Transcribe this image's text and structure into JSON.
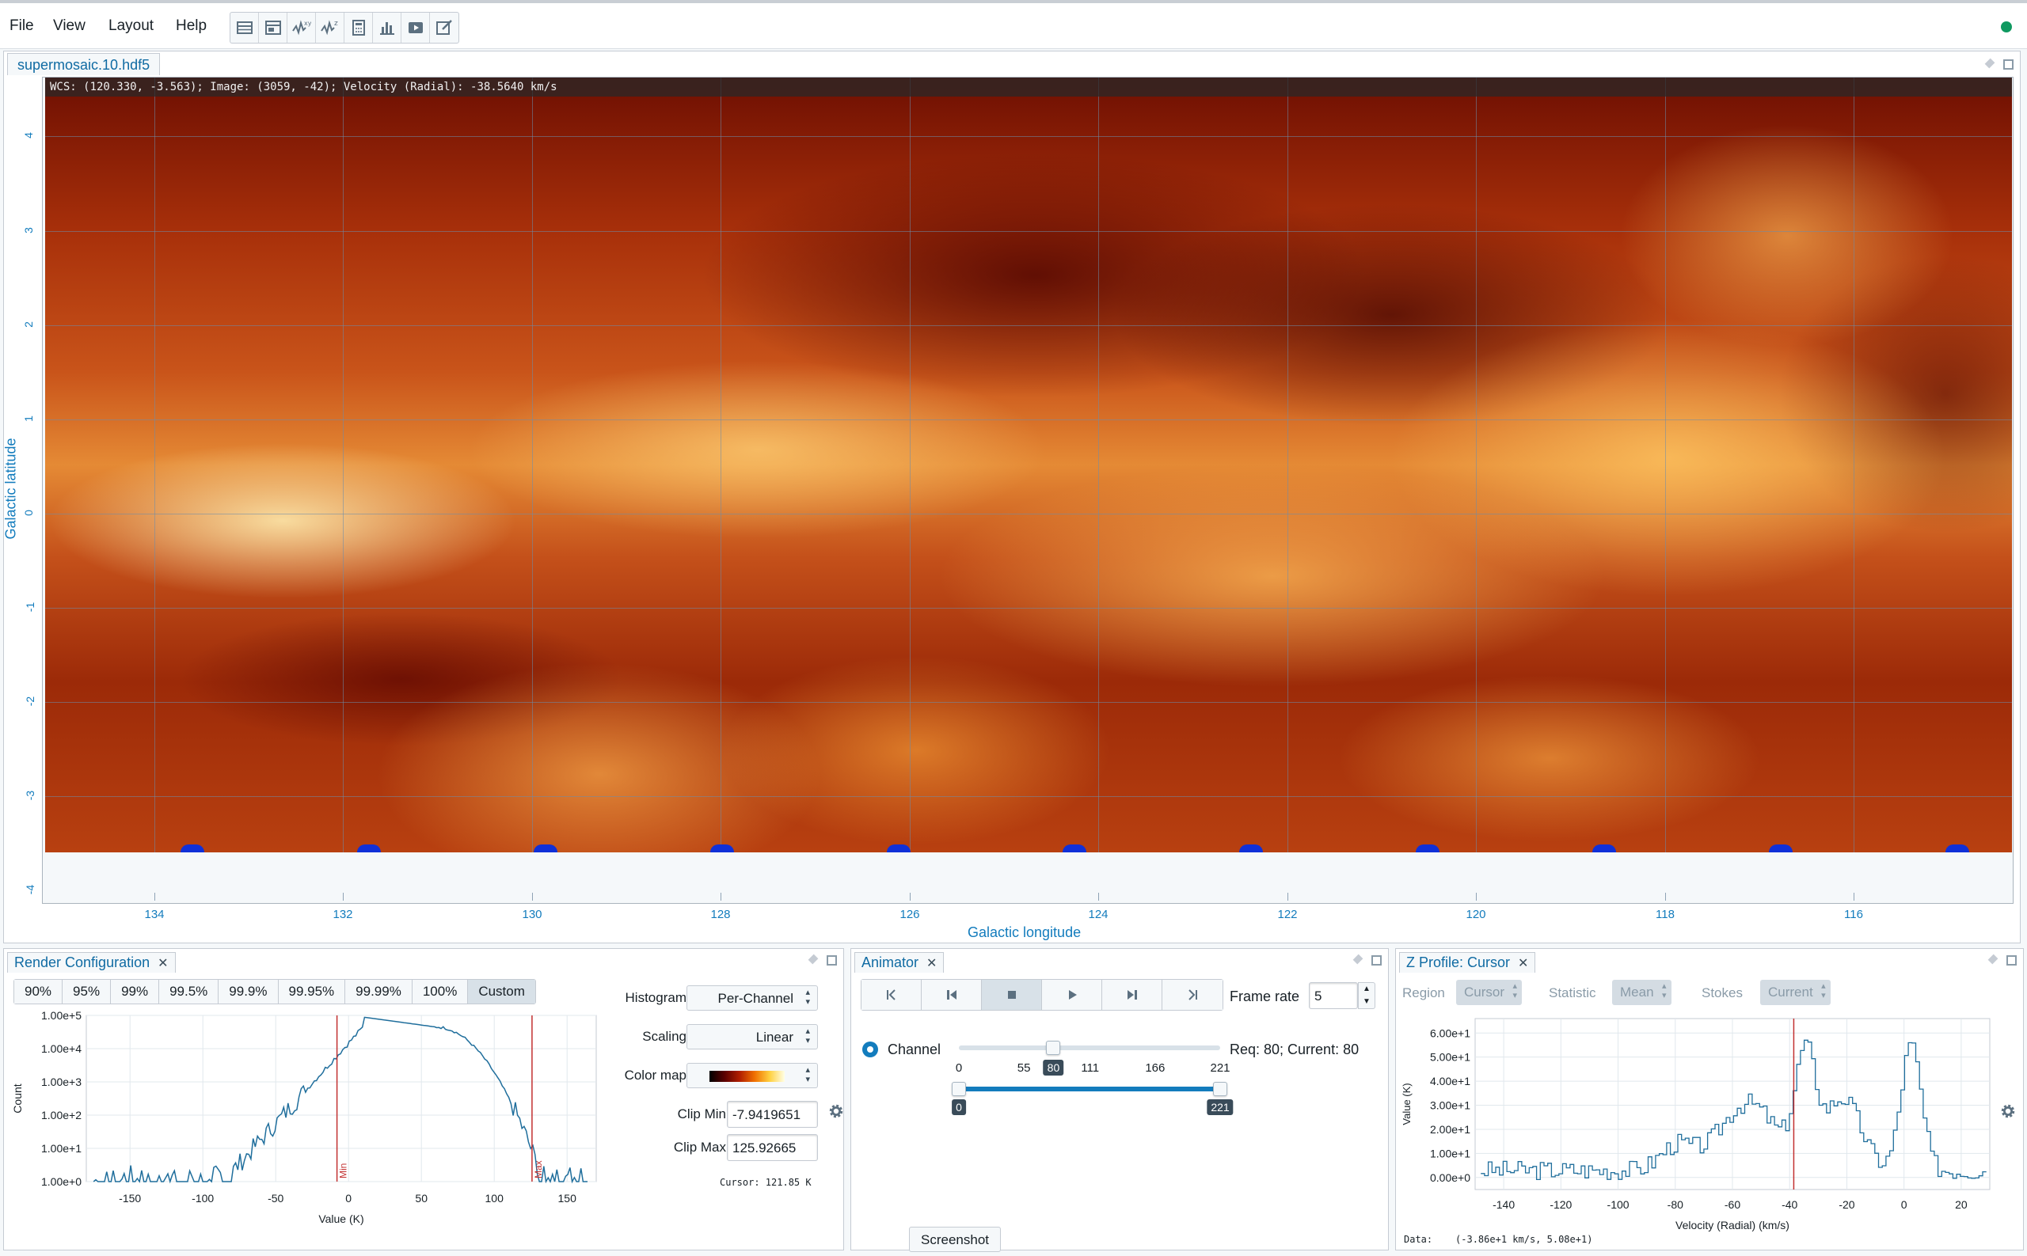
{
  "menu": {
    "file": "File",
    "view": "View",
    "layout": "Layout",
    "help": "Help"
  },
  "toolbar": {
    "icons": [
      "table-icon",
      "layout-icon",
      "xy-profile-icon",
      "z-profile-icon",
      "calculator-icon",
      "histogram-icon",
      "animator-icon",
      "edit-icon"
    ],
    "xy_sup": "xy",
    "z_sup": "z"
  },
  "status": {
    "color": "#0f9960"
  },
  "viewer": {
    "tab_label": "supermosaic.10.hdf5",
    "cursor_info": "WCS: (120.330, -3.563); Image: (3059, -42); Velocity (Radial): -38.5640 km/s",
    "x_axis_title": "Galactic longitude",
    "y_axis_title": "Galactic latitude",
    "x_ticks": [
      "134",
      "132",
      "130",
      "128",
      "126",
      "124",
      "122",
      "120",
      "118",
      "116"
    ],
    "y_ticks": [
      "4",
      "3",
      "2",
      "1",
      "0",
      "-1",
      "-2",
      "-3",
      "-4"
    ],
    "colormap": "hot"
  },
  "render_config": {
    "tab_label": "Render Configuration",
    "percentiles": [
      "90%",
      "95%",
      "99%",
      "99.5%",
      "99.9%",
      "99.95%",
      "99.99%",
      "100%",
      "Custom"
    ],
    "selected_percentile": "Custom",
    "histogram_label": "Histogram",
    "histogram_value": "Per-Channel",
    "scaling_label": "Scaling",
    "scaling_value": "Linear",
    "colormap_label": "Color map",
    "clip_min_label": "Clip Min",
    "clip_min_value": "-7.9419651",
    "clip_max_label": "Clip Max",
    "clip_max_value": "125.92665",
    "cursor_text": "Cursor: 121.85 K",
    "y_ticks": [
      "1.00e+5",
      "1.00e+4",
      "1.00e+3",
      "1.00e+2",
      "1.00e+1",
      "1.00e+0"
    ],
    "x_ticks": [
      "-150",
      "-100",
      "-50",
      "0",
      "50",
      "100",
      "150"
    ],
    "x_axis_title": "Value (K)",
    "y_axis_title": "Count",
    "min_marker": "Min",
    "max_marker": "Max",
    "clip_min": -7.94,
    "clip_max": 125.93
  },
  "animator": {
    "tab_label": "Animator",
    "frame_rate_label": "Frame rate",
    "frame_rate_value": "5",
    "channel_label": "Channel",
    "channel_status": "Req: 80; Current: 80",
    "slider_labels": [
      "0",
      "55",
      "111",
      "166",
      "221"
    ],
    "current_channel": "80",
    "range_min": "0",
    "range_max": "221",
    "channel_max": 221
  },
  "zprofile": {
    "tab_label": "Z Profile: Cursor",
    "region_label": "Region",
    "region_value": "Cursor",
    "statistic_label": "Statistic",
    "statistic_value": "Mean",
    "stokes_label": "Stokes",
    "stokes_value": "Current",
    "y_ticks": [
      "6.00e+1",
      "5.00e+1",
      "4.00e+1",
      "3.00e+1",
      "2.00e+1",
      "1.00e+1",
      "0.00e+0"
    ],
    "x_ticks": [
      "-140",
      "-120",
      "-100",
      "-80",
      "-60",
      "-40",
      "-20",
      "0",
      "20"
    ],
    "x_axis_title": "Velocity (Radial) (km/s)",
    "y_axis_title": "Value (K)",
    "data_text": "Data:    (-3.86e+1 km/s, 5.08e+1)",
    "marker_velocity": -38.56
  },
  "screenshot_label": "Screenshot"
}
